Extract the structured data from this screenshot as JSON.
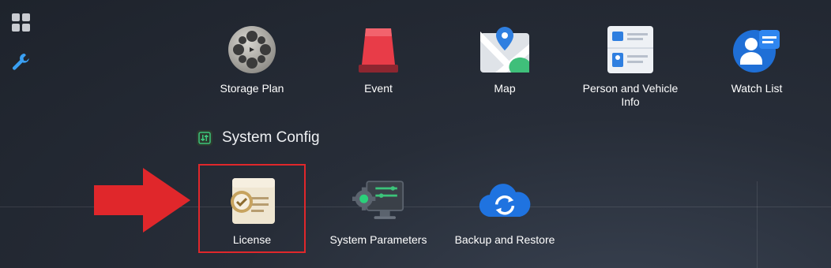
{
  "sidebar": {
    "items": [
      {
        "name": "apps-grid-icon"
      },
      {
        "name": "wrench-icon"
      }
    ],
    "active_color": "#3aa0f3"
  },
  "top_row": [
    {
      "label": "Storage Plan",
      "icon": "film-reel-icon"
    },
    {
      "label": "Event",
      "icon": "alarm-light-icon"
    },
    {
      "label": "Map",
      "icon": "map-pin-icon"
    },
    {
      "label": "Person and Vehicle Info",
      "icon": "id-card-icon"
    },
    {
      "label": "Watch List",
      "icon": "person-list-icon"
    }
  ],
  "system_config": {
    "title": "System Config",
    "items": [
      {
        "label": "License",
        "icon": "license-certificate-icon"
      },
      {
        "label": "System Parameters",
        "icon": "system-parameters-icon"
      },
      {
        "label": "Backup and Restore",
        "icon": "cloud-sync-icon"
      }
    ]
  },
  "annotation": {
    "color": "#e0272b"
  }
}
